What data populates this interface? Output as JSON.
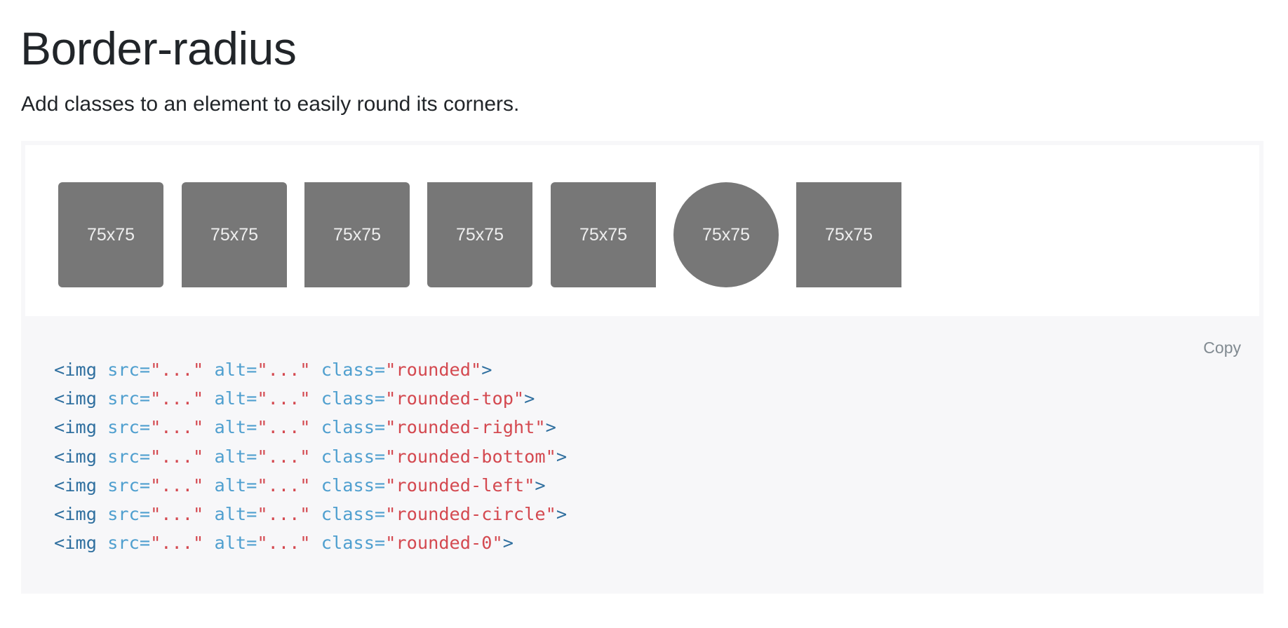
{
  "page": {
    "title": "Border-radius",
    "lead": "Add classes to an element to easily round its corners."
  },
  "example": {
    "thumbnails": [
      {
        "label": "75x75",
        "class": "rounded"
      },
      {
        "label": "75x75",
        "class": "rounded-top"
      },
      {
        "label": "75x75",
        "class": "rounded-right"
      },
      {
        "label": "75x75",
        "class": "rounded-bottom"
      },
      {
        "label": "75x75",
        "class": "rounded-left"
      },
      {
        "label": "75x75",
        "class": "rounded-circle"
      },
      {
        "label": "75x75",
        "class": "rounded-0"
      }
    ]
  },
  "code": {
    "copy_label": "Copy",
    "lines": [
      {
        "open": "<img",
        "src_attr": " src=",
        "src_val": "\"...\"",
        "alt_attr": " alt=",
        "alt_val": "\"...\"",
        "class_attr": " class=",
        "class_val": "\"rounded\"",
        "close": ">"
      },
      {
        "open": "<img",
        "src_attr": " src=",
        "src_val": "\"...\"",
        "alt_attr": " alt=",
        "alt_val": "\"...\"",
        "class_attr": " class=",
        "class_val": "\"rounded-top\"",
        "close": ">"
      },
      {
        "open": "<img",
        "src_attr": " src=",
        "src_val": "\"...\"",
        "alt_attr": " alt=",
        "alt_val": "\"...\"",
        "class_attr": " class=",
        "class_val": "\"rounded-right\"",
        "close": ">"
      },
      {
        "open": "<img",
        "src_attr": " src=",
        "src_val": "\"...\"",
        "alt_attr": " alt=",
        "alt_val": "\"...\"",
        "class_attr": " class=",
        "class_val": "\"rounded-bottom\"",
        "close": ">"
      },
      {
        "open": "<img",
        "src_attr": " src=",
        "src_val": "\"...\"",
        "alt_attr": " alt=",
        "alt_val": "\"...\"",
        "class_attr": " class=",
        "class_val": "\"rounded-left\"",
        "close": ">"
      },
      {
        "open": "<img",
        "src_attr": " src=",
        "src_val": "\"...\"",
        "alt_attr": " alt=",
        "alt_val": "\"...\"",
        "class_attr": " class=",
        "class_val": "\"rounded-circle\"",
        "close": ">"
      },
      {
        "open": "<img",
        "src_attr": " src=",
        "src_val": "\"...\"",
        "alt_attr": " alt=",
        "alt_val": "\"...\"",
        "class_attr": " class=",
        "class_val": "\"rounded-0\"",
        "close": ">"
      }
    ]
  },
  "colors": {
    "thumbnail_fill": "#777777",
    "thumbnail_text": "#eeeeee",
    "code_background": "#f7f7f9",
    "code_tag": "#2f6f9f",
    "code_attribute": "#4f9fcf",
    "code_string": "#d44950",
    "copy_text": "#818a91"
  }
}
